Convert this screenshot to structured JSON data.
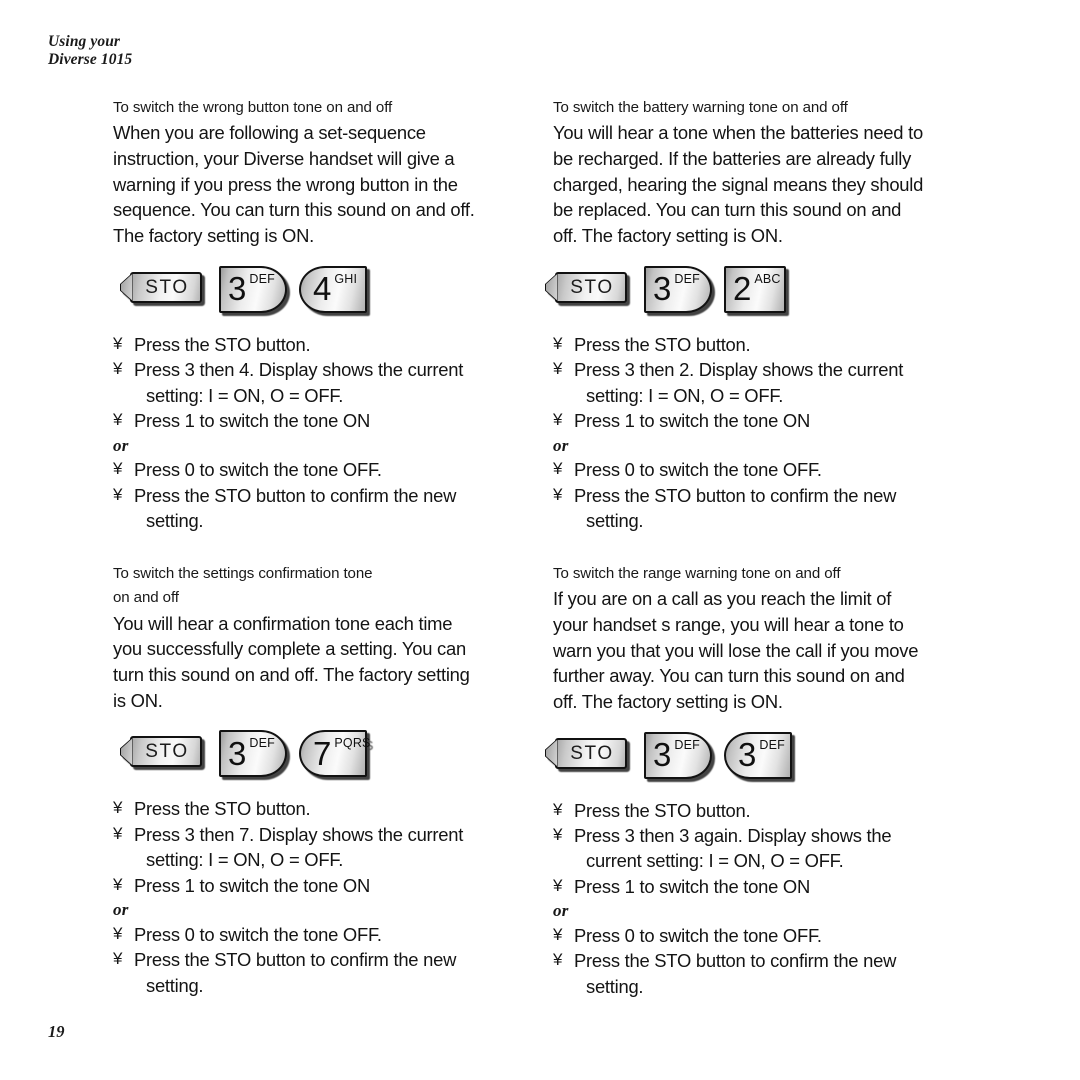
{
  "running_head": {
    "line1": "Using your",
    "line2": "Diverse 1015"
  },
  "folio": "19",
  "bullet_glyph": "¥",
  "or_label": "or",
  "sections": [
    {
      "id": "wrong-button-tone",
      "column": "left",
      "heading_lines": [
        "To switch the  wrong button  tone on and off"
      ],
      "body_lines": [
        "When you are following a set-sequence",
        "instruction, your Diverse handset will give a",
        "warning if you press the wrong button in the",
        "sequence. You can turn this sound on and off.",
        "The factory setting is ON."
      ],
      "keys": [
        {
          "type": "sto",
          "label": "STO",
          "edge": "none"
        },
        {
          "type": "digit",
          "digit": "3",
          "letters": "DEF",
          "edge": "right"
        },
        {
          "type": "digit",
          "digit": "4",
          "letters": "GHI",
          "edge": "left"
        }
      ],
      "steps": [
        {
          "lines": [
            "Press the STO button."
          ]
        },
        {
          "lines": [
            "Press 3 then 4. Display shows the current",
            "setting: I = ON, O = OFF."
          ]
        },
        {
          "lines": [
            "Press 1 to switch the tone ON"
          ]
        },
        {
          "or": true
        },
        {
          "lines": [
            "Press 0 to switch the tone OFF."
          ]
        },
        {
          "lines": [
            "Press the STO button to confirm the new",
            "setting."
          ]
        }
      ]
    },
    {
      "id": "settings-confirmation-tone",
      "column": "left",
      "heading_lines": [
        "To switch the  settings confirmation  tone",
        "on and off"
      ],
      "body_lines": [
        "You will hear a confirmation tone each time",
        "you successfully complete a setting. You can",
        "turn this sound on and off. The factory setting",
        "is ON."
      ],
      "keys": [
        {
          "type": "sto",
          "label": "STO",
          "edge": "none"
        },
        {
          "type": "digit",
          "digit": "3",
          "letters": "DEF",
          "edge": "right"
        },
        {
          "type": "digit",
          "digit": "7",
          "letters": "PQRS",
          "edge": "left"
        }
      ],
      "steps": [
        {
          "lines": [
            "Press the STO button."
          ]
        },
        {
          "lines": [
            "Press 3 then 7. Display shows the current",
            "setting: I = ON, O = OFF."
          ]
        },
        {
          "lines": [
            "Press 1 to switch the tone ON"
          ]
        },
        {
          "or": true
        },
        {
          "lines": [
            "Press 0 to switch the tone OFF."
          ]
        },
        {
          "lines": [
            "Press the STO button to confirm the new",
            "setting."
          ]
        }
      ]
    },
    {
      "id": "battery-warning-tone",
      "column": "right",
      "heading_lines": [
        "To switch the battery warning tone on and off"
      ],
      "body_lines": [
        "You will hear a tone when the batteries need to",
        "be recharged. If the batteries are already fully",
        "charged, hearing the signal means they should",
        "be replaced. You can turn this sound on and",
        "off. The factory setting is ON."
      ],
      "keys": [
        {
          "type": "sto",
          "label": "STO",
          "edge": "none"
        },
        {
          "type": "digit",
          "digit": "3",
          "letters": "DEF",
          "edge": "right"
        },
        {
          "type": "digit",
          "digit": "2",
          "letters": "ABC",
          "edge": "none"
        }
      ],
      "steps": [
        {
          "lines": [
            "Press the STO button."
          ]
        },
        {
          "lines": [
            "Press 3 then 2. Display shows the current",
            "setting: I = ON, O = OFF."
          ]
        },
        {
          "lines": [
            "Press 1 to switch the tone ON"
          ]
        },
        {
          "or": true
        },
        {
          "lines": [
            "Press 0 to switch the tone OFF."
          ]
        },
        {
          "lines": [
            "Press the STO button to confirm the new",
            "setting."
          ]
        }
      ]
    },
    {
      "id": "range-warning-tone",
      "column": "right",
      "heading_lines": [
        "To switch the  range warning  tone on and off"
      ],
      "body_lines": [
        "If you are on a call as you reach the limit of",
        "your handset s range, you will hear a tone to",
        "warn you that you will lose the call if you move",
        "further away. You can turn this sound on and",
        "off. The factory setting is ON."
      ],
      "keys": [
        {
          "type": "sto",
          "label": "STO",
          "edge": "none"
        },
        {
          "type": "digit",
          "digit": "3",
          "letters": "DEF",
          "edge": "right"
        },
        {
          "type": "digit",
          "digit": "3",
          "letters": "DEF",
          "edge": "left"
        }
      ],
      "steps": [
        {
          "lines": [
            "Press the STO button."
          ]
        },
        {
          "lines": [
            "Press 3 then 3 again. Display shows the",
            "current setting: I = ON, O = OFF."
          ]
        },
        {
          "lines": [
            "Press 1 to switch the tone ON"
          ]
        },
        {
          "or": true
        },
        {
          "lines": [
            "Press 0 to switch the tone OFF."
          ]
        },
        {
          "lines": [
            "Press the STO button to confirm the new",
            "setting."
          ]
        }
      ]
    }
  ]
}
